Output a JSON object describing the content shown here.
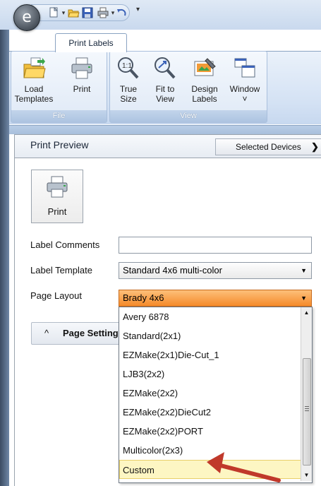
{
  "app": {
    "tab_label": "Print Labels"
  },
  "ribbon": {
    "file_group": {
      "label": "File",
      "buttons": [
        {
          "label": "Load\nTemplates",
          "icon": "folder-icon"
        },
        {
          "label": "Print",
          "icon": "printer-icon"
        }
      ]
    },
    "view_group": {
      "label": "View",
      "buttons": [
        {
          "label": "True\nSize",
          "icon": "magnifier-icon"
        },
        {
          "label": "Fit to\nView",
          "icon": "magnifier-fit-icon"
        },
        {
          "label": "Design\nLabels",
          "icon": "design-labels-icon"
        },
        {
          "label": "Window\n˅",
          "icon": "window-icon"
        }
      ]
    }
  },
  "panel": {
    "title": "Print Preview",
    "selected_devices_label": "Selected Devices",
    "selected_devices_arrow": "❯",
    "print_button_label": "Print",
    "label_comments": {
      "label": "Label Comments",
      "value": ""
    },
    "label_template": {
      "label": "Label Template",
      "value": "Standard 4x6 multi-color"
    },
    "page_layout": {
      "label": "Page Layout",
      "value": "Brady 4x6"
    },
    "page_settings_label": "Page Setting",
    "page_settings_chevron": "^"
  },
  "dropdown": {
    "options": [
      "Avery 6878",
      "Standard(2x1)",
      "EZMake(2x1)Die-Cut_1",
      "LJB3(2x2)",
      "EZMake(2x2)",
      "EZMake(2x2)DieCut2",
      "EZMake(2x2)PORT",
      "Multicolor(2x3)",
      "Custom"
    ],
    "highlighted": "Custom"
  },
  "colors": {
    "accent_orange": "#f58a2a",
    "highlight_yellow": "#fdf6c3",
    "annotation_arrow": "#c0392b"
  }
}
